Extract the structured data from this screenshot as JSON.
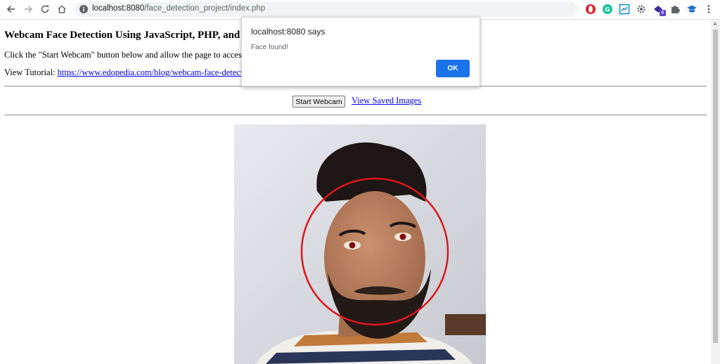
{
  "browser": {
    "url_host": "localhost:8080",
    "url_path": "/face_detection_project/index.php",
    "extensions": [
      "opera-icon",
      "grammarly-icon",
      "screen-capture-icon",
      "settings-gear-icon",
      "extension-stack-icon",
      "puzzle-icon",
      "graduation-cap-icon",
      "menu-dots-icon"
    ],
    "extension_badge": "6"
  },
  "page": {
    "title": "Webcam Face Detection Using JavaScript, PHP, and My",
    "intro": "Click the \"Start Webcam\" button below and allow the page to access y",
    "tutorial_label": "View Tutorial: ",
    "tutorial_link": "https://www.edopedia.com/blog/webcam-face-detection",
    "start_button": "Start Webcam",
    "saved_images_link": "View Saved Images",
    "link_color": "#0000ee"
  },
  "dialog": {
    "origin": "localhost:8080 says",
    "message": "Face found!",
    "ok_label": "OK",
    "accent": "#1a73e8"
  },
  "detection": {
    "circle_color": "#e0141c",
    "status": "face detected"
  }
}
